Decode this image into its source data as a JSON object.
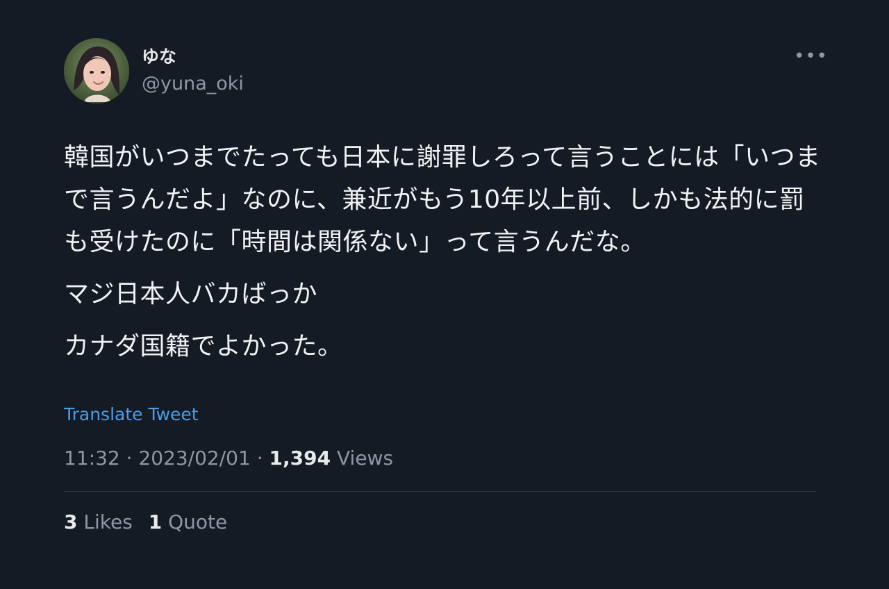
{
  "tweet": {
    "author": {
      "display_name": "ゆな",
      "handle": "@yuna_oki"
    },
    "more_label": "•••",
    "body": {
      "paragraph_1": "韓国がいつまでたっても日本に謝罪しろって言うことには「いつまで言うんだよ」なのに、兼近がもう10年以上前、しかも法的に罰も受けたのに「時間は関係ない」って言うんだな。",
      "paragraph_2": "マジ日本人バカばっか",
      "paragraph_3": "カナダ国籍でよかった。"
    },
    "translate_label": "Translate Tweet",
    "meta": {
      "time": "11:32",
      "separator_1": "·",
      "date": "2023/02/01",
      "separator_2": "·",
      "views_count": "1,394",
      "views_label": "Views"
    },
    "stats": {
      "likes_count": "3",
      "likes_label": "Likes",
      "quote_count": "1",
      "quote_label": "Quote"
    }
  },
  "colors": {
    "background": "#151b25",
    "primary_text": "#e7e9ea",
    "secondary_text": "#8b98a5",
    "link": "#4c9ce8",
    "divider": "#313944"
  }
}
